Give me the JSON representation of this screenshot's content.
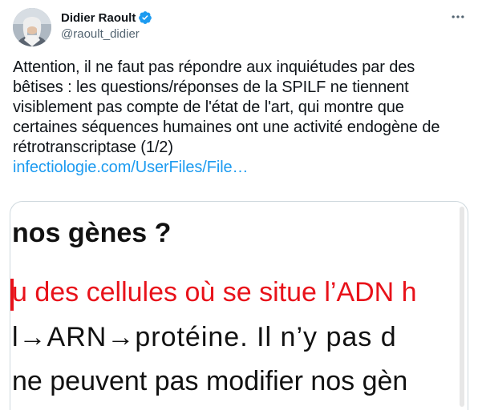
{
  "author": {
    "display_name": "Didier Raoult",
    "handle": "@raoult_didier",
    "verified": true
  },
  "tweet": {
    "text": "Attention, il ne faut pas répondre aux inquiétudes par des bêtises : les questions/réponses de la SPILF ne tiennent visiblement pas compte de l'état de l'art, qui montre que certaines séquences humaines ont une activité endogène de rétrotranscriptase (1/2)",
    "link_text": "infectiologie.com/UserFiles/File…"
  },
  "media": {
    "lines": [
      "nos gènes ?",
      "u des cellules où se situe l’ADN h",
      "l→ARN→protéine. Il n’y pas d",
      "ne peuvent pas modifier nos gèn"
    ]
  },
  "icons": {
    "verified": "verified-badge-icon",
    "more": "more-options-icon"
  },
  "colors": {
    "link": "#1d9bf0",
    "verified": "#1d9bf0",
    "slide_red": "#e8121a"
  }
}
